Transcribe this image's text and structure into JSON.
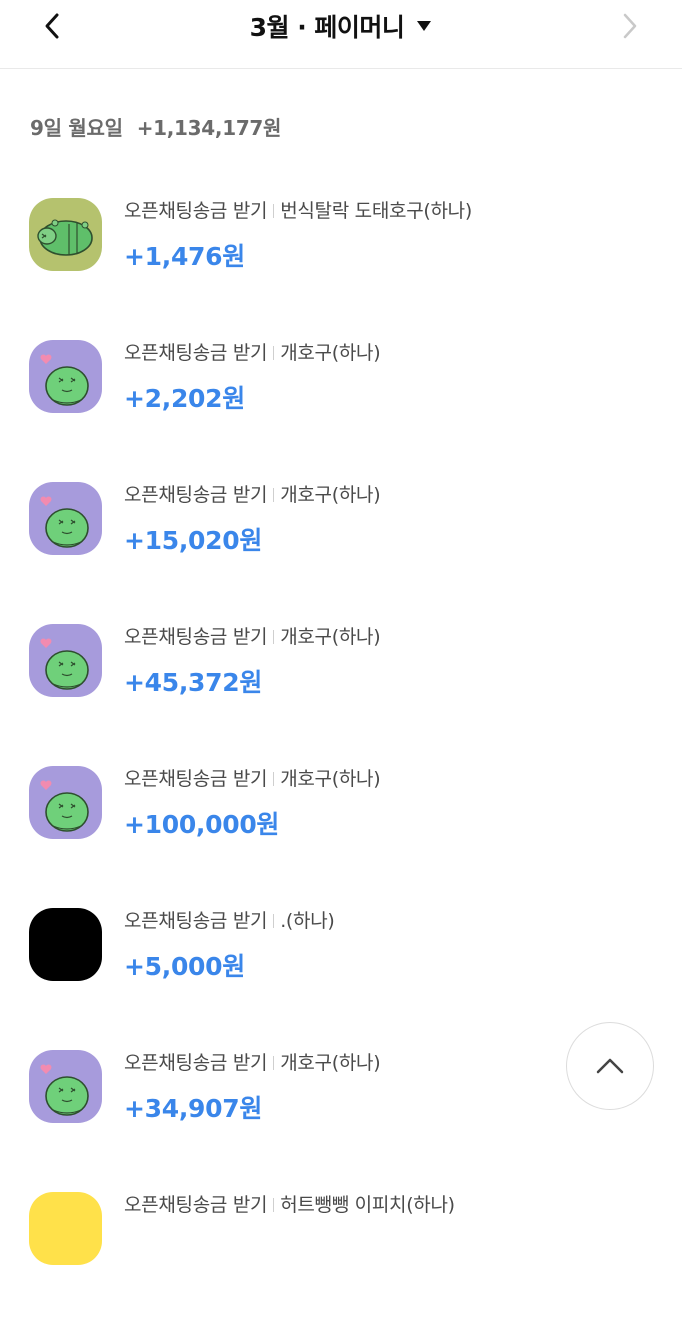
{
  "header": {
    "title": "3월 · 페이머니",
    "back_icon": "chevron-left-icon",
    "next_icon": "chevron-right-icon",
    "dropdown_icon": "caret-down-icon"
  },
  "day": {
    "label": "9일 월요일",
    "total": "+1,134,177원"
  },
  "transactions": [
    {
      "title": "오픈채팅송금 받기",
      "sender": "번식탈락 도태호구(하나)",
      "amount": "+1,476원",
      "avatar": "olive"
    },
    {
      "title": "오픈채팅송금 받기",
      "sender": "개호구(하나)",
      "amount": "+2,202원",
      "avatar": "purple"
    },
    {
      "title": "오픈채팅송금 받기",
      "sender": "개호구(하나)",
      "amount": "+15,020원",
      "avatar": "purple"
    },
    {
      "title": "오픈채팅송금 받기",
      "sender": "개호구(하나)",
      "amount": "+45,372원",
      "avatar": "purple"
    },
    {
      "title": "오픈채팅송금 받기",
      "sender": "개호구(하나)",
      "amount": "+100,000원",
      "avatar": "purple"
    },
    {
      "title": "오픈채팅송금 받기",
      "sender": ".(하나)",
      "amount": "+5,000원",
      "avatar": "black"
    },
    {
      "title": "오픈채팅송금 받기",
      "sender": "개호구(하나)",
      "amount": "+34,907원",
      "avatar": "purple"
    },
    {
      "title": "오픈채팅송금 받기",
      "sender": "허트뺑뺑 이피치(하나)",
      "amount": "",
      "avatar": "yellow"
    }
  ],
  "scroll_top_icon": "chevron-up-icon",
  "colors": {
    "amount": "#3a86ea",
    "avatar_olive": "#b5c26e",
    "avatar_purple": "#a79bdc",
    "avatar_black": "#000000",
    "avatar_yellow": "#ffe14a"
  }
}
